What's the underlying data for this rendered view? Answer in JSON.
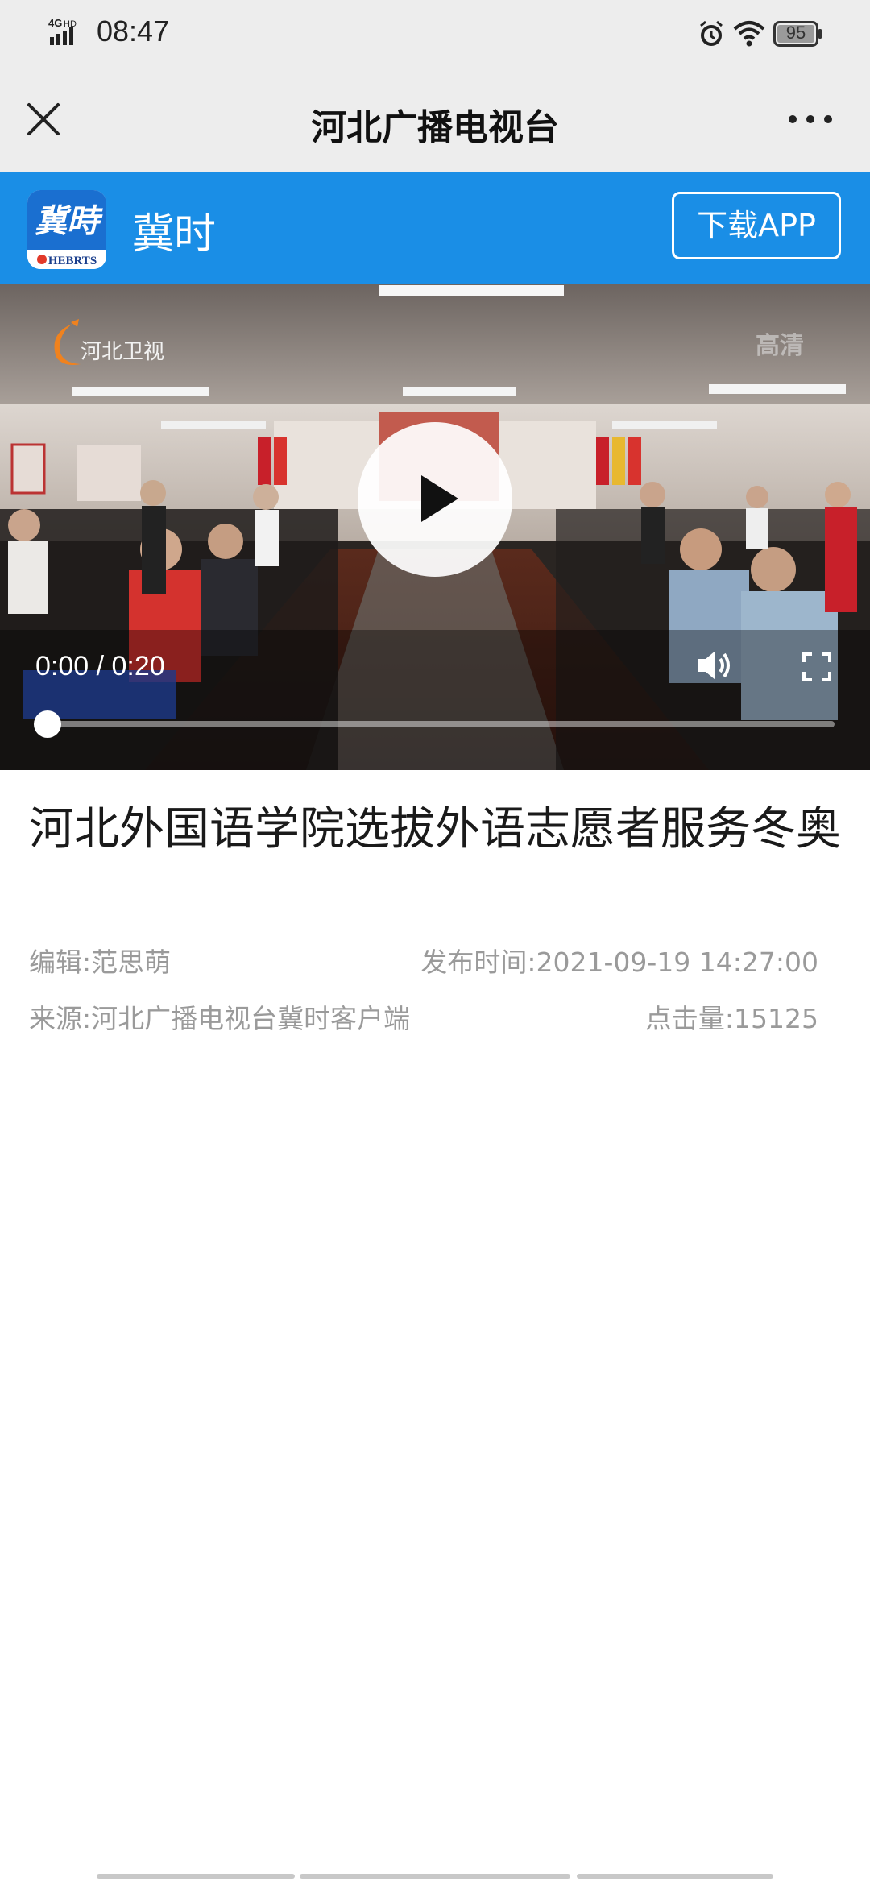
{
  "status_bar": {
    "network": "4G HD",
    "time": "08:47",
    "battery": "95"
  },
  "nav": {
    "title": "河北广播电视台"
  },
  "app_banner": {
    "name": "冀时",
    "logo_text": "冀時",
    "logo_subtext": "HEBRTS",
    "download_label": "下载APP",
    "background_color": "#1a8ee6"
  },
  "video": {
    "channel_name": "河北卫视",
    "hd_badge": "高清",
    "time_display": "0:00 / 0:20",
    "progress": 0.0,
    "icons": [
      "play-icon",
      "volume-icon",
      "fullscreen-icon"
    ]
  },
  "article": {
    "title": "河北外国语学院选拔外语志愿者服务冬奥",
    "editor": "编辑:范思萌",
    "publish_time": "发布时间:2021-09-19 14:27:00",
    "source": "来源:河北广播电视台冀时客户端",
    "clicks": "点击量:15125"
  }
}
